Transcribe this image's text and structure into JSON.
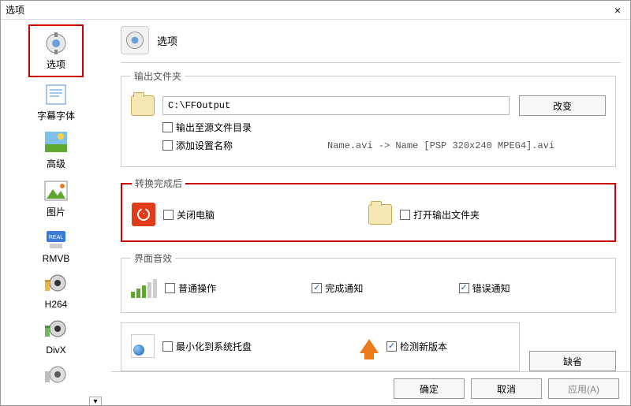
{
  "window": {
    "title": "选项"
  },
  "sidebar": {
    "items": [
      {
        "label": "选项"
      },
      {
        "label": "字幕字体"
      },
      {
        "label": "高级"
      },
      {
        "label": "图片"
      },
      {
        "label": "RMVB"
      },
      {
        "label": "H264"
      },
      {
        "label": "DivX"
      }
    ],
    "selected_index": 0
  },
  "header": {
    "title": "选项"
  },
  "output_folder": {
    "legend": "输出文件夹",
    "path": "C:\\FFOutput",
    "change_button": "改变",
    "to_source_checkbox": "输出至源文件目录",
    "add_settings_checkbox": "添加设置名称",
    "example": "Name.avi  -> Name [PSP 320x240 MPEG4].avi"
  },
  "after_convert": {
    "legend": "转换完成后",
    "shutdown_checkbox": "关闭电脑",
    "open_folder_checkbox": "打开输出文件夹"
  },
  "sound": {
    "legend": "界面音效",
    "normal_checkbox": "普通操作",
    "complete_checkbox": "完成通知",
    "error_checkbox": "错误通知"
  },
  "misc": {
    "minimize_tray_checkbox": "最小化到系统托盘",
    "check_update_checkbox": "检测新版本",
    "default_button": "缺省"
  },
  "footer": {
    "ok": "确定",
    "cancel": "取消",
    "apply": "应用(A)"
  }
}
